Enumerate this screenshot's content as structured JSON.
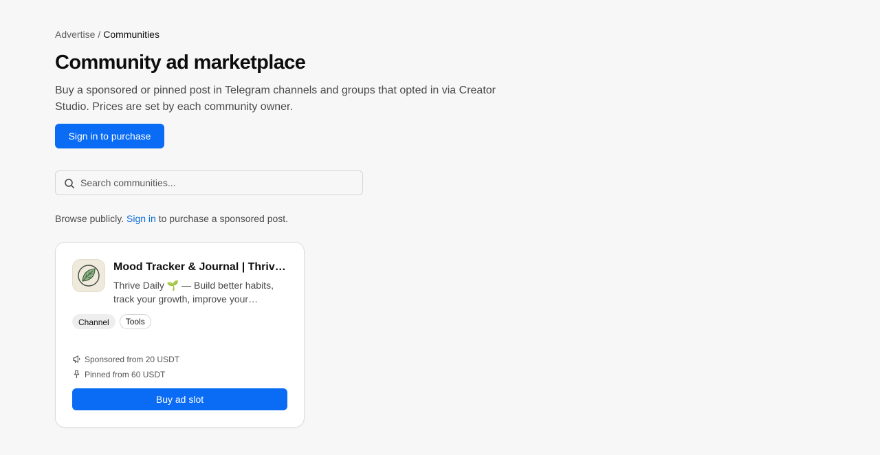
{
  "breadcrumb": {
    "parent": "Advertise",
    "separator": "/",
    "current": "Communities"
  },
  "header": {
    "title": "Community ad marketplace",
    "description": "Buy a sponsored or pinned post in Telegram channels and groups that opted in via Creator Studio. Prices are set by each community owner.",
    "sign_in_button": "Sign in to purchase"
  },
  "search": {
    "placeholder": "Search communities...",
    "value": ""
  },
  "browse_note": {
    "prefix": "Browse publicly.",
    "link": "Sign in",
    "suffix": "to purchase a sponsored post."
  },
  "communities": [
    {
      "avatar_icon": "leaf-icon",
      "title": "Mood Tracker & Journal | Thrive Daily",
      "description": "Thrive Daily 🌱 — Build better habits, track your growth, improve your wellbeing.",
      "tags": [
        "Channel",
        "Tools"
      ],
      "sponsored_label": "Sponsored from 20 USDT",
      "pinned_label": "Pinned from 60 USDT",
      "buy_button": "Buy ad slot"
    }
  ],
  "colors": {
    "accent": "#0a6cf5",
    "link": "#0a6cd8",
    "background": "#f7f7f7"
  }
}
